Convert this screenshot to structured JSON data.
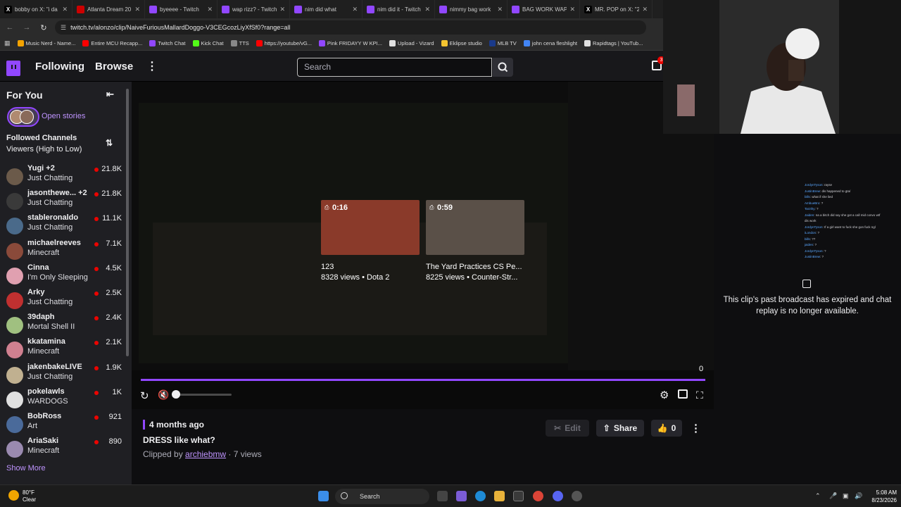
{
  "browser": {
    "tabs": [
      {
        "title": "bobby on X: \"i da",
        "color": "#000000",
        "glyph": "X"
      },
      {
        "title": "Atlanta Dream 20",
        "color": "#cc0000",
        "glyph": ""
      },
      {
        "title": "byeeee - Twitch",
        "color": "#9147ff",
        "glyph": ""
      },
      {
        "title": "wap rizz? - Twitch",
        "color": "#9147ff",
        "glyph": ""
      },
      {
        "title": "nim did what",
        "color": "#9147ff",
        "glyph": ""
      },
      {
        "title": "nim did it - Twitch",
        "color": "#9147ff",
        "glyph": ""
      },
      {
        "title": "nimmy bag work",
        "color": "#9147ff",
        "glyph": ""
      },
      {
        "title": "BAG WORK WAP",
        "color": "#9147ff",
        "glyph": ""
      },
      {
        "title": "MR. POP on X: \"2",
        "color": "#000000",
        "glyph": "X"
      }
    ],
    "url": "twitch.tv/alonzo/clip/NaiveFuriousMallardDoggo-V3CEGcozLiyXfSf0?range=all",
    "bookmarks": [
      {
        "label": "Music Nerd - Name...",
        "color": "#f4a300"
      },
      {
        "label": "Entire MCU Recapp...",
        "color": "#ff0000"
      },
      {
        "label": "Twitch Chat",
        "color": "#9147ff"
      },
      {
        "label": "Kick Chat",
        "color": "#53fc18"
      },
      {
        "label": "TTS",
        "color": "#888888"
      },
      {
        "label": "https://youtube/vG...",
        "color": "#ff0000"
      },
      {
        "label": "Pink FRIDAYY W KPI...",
        "color": "#9147ff"
      },
      {
        "label": "Upload - Vizard",
        "color": "#e0e0e0"
      },
      {
        "label": "Eklipse studio",
        "color": "#f4c430"
      },
      {
        "label": "MLB TV",
        "color": "#1a3a8a"
      },
      {
        "label": "john cena fleshlight",
        "color": "#4285f4"
      },
      {
        "label": "Rapidtags | YouTub...",
        "color": "#e0e0e0"
      }
    ]
  },
  "nav": {
    "following": "Following",
    "browse": "Browse",
    "search_placeholder": "Search",
    "notif_count": "3"
  },
  "sidebar": {
    "for_you": "For You",
    "open_stories": "Open stories",
    "followed_title": "Followed Channels",
    "followed_sort": "Viewers (High to Low)",
    "show_more": "Show More",
    "channels": [
      {
        "name": "Yugi +2",
        "game": "Just Chatting",
        "viewers": "21.8K",
        "color": "#6b5a4a"
      },
      {
        "name": "jasonthewe... +2",
        "game": "Just Chatting",
        "viewers": "21.8K",
        "color": "#3a3a3a"
      },
      {
        "name": "stableronaldo",
        "game": "Just Chatting",
        "viewers": "11.1K",
        "color": "#4a6a8a"
      },
      {
        "name": "michaelreeves",
        "game": "Minecraft",
        "viewers": "7.1K",
        "color": "#8a4a3a"
      },
      {
        "name": "Cinna",
        "game": "I'm Only Sleeping",
        "viewers": "4.5K",
        "color": "#e0a0b0"
      },
      {
        "name": "Arky",
        "game": "Just Chatting",
        "viewers": "2.5K",
        "color": "#c03030"
      },
      {
        "name": "39daph",
        "game": "Mortal Shell II",
        "viewers": "2.4K",
        "color": "#a0c080"
      },
      {
        "name": "kkatamina",
        "game": "Minecraft",
        "viewers": "2.1K",
        "color": "#d08090"
      },
      {
        "name": "jakenbakeLIVE",
        "game": "Just Chatting",
        "viewers": "1.9K",
        "color": "#c0b090"
      },
      {
        "name": "pokelawls",
        "game": "WARDOGS",
        "viewers": "1K",
        "color": "#e0e0e0"
      },
      {
        "name": "BobRoss",
        "game": "Art",
        "viewers": "921",
        "color": "#4a6a9a"
      },
      {
        "name": "AriaSaki",
        "game": "Minecraft",
        "viewers": "890",
        "color": "#9a8ab0"
      }
    ]
  },
  "player": {
    "recommended": [
      {
        "duration": "0:16",
        "title": "123",
        "meta": "8328 views • Dota 2",
        "color": "#8a3a2a"
      },
      {
        "duration": "0:59",
        "title": "The Yard Practices CS Pe...",
        "meta": "8225 views • Counter-Str...",
        "color": "#5a5048"
      }
    ],
    "counter": "0",
    "volume": 0.0
  },
  "clip": {
    "ago": "4 months ago",
    "title": "DRESS like what?",
    "clipped_by_prefix": "Clipped by",
    "clipper": "archiebmw",
    "views": " · 7 views",
    "edit": "Edit",
    "share": "Share",
    "likes": "0"
  },
  "chat": {
    "mini_lines": [
      {
        "user": "JordynTyson",
        "msg": ": rayse"
      },
      {
        "user": "JustinBrew",
        "msg": ": dis happened to gta/"
      },
      {
        "user": "bills",
        "msg": ": what if she lied"
      },
      {
        "user": "AmbueBro",
        "msg": ": ?"
      },
      {
        "user": "Tarzthy",
        "msg": ": ?"
      },
      {
        "user": "Jaiden",
        "msg": ": na a bitch did say she got a call mid convo wtf"
      },
      {
        "user": "",
        "msg": "dis work"
      },
      {
        "user": "JordynTyson",
        "msg": ": If a girl want to fuck she gon fuck ngl"
      },
      {
        "user": "iLondon",
        "msg": ": ?"
      },
      {
        "user": "bills",
        "msg": ": ??"
      },
      {
        "user": "jaiden",
        "msg": ": ?"
      },
      {
        "user": "JordynTyson",
        "msg": ": ?"
      },
      {
        "user": "JustinBrew",
        "msg": ": ?"
      }
    ],
    "expired": "This clip's past broadcast has expired and chat replay is no longer available."
  },
  "taskbar": {
    "temp": "80°F",
    "weather": "Clear",
    "search": "Search",
    "time": "5:08 AM",
    "date": "8/23/2026"
  }
}
